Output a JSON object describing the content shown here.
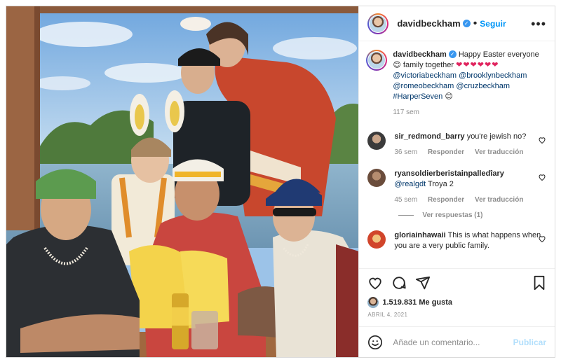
{
  "post": {
    "username": "davidbeckham",
    "follow_label": "Seguir",
    "more_label": "•••",
    "separator": "•"
  },
  "caption": {
    "username": "davidbeckham",
    "text_1": "Happy Easter everyone",
    "text_2": "family together",
    "hearts": "❤❤❤❤❤❤",
    "mentions": [
      "@victoriabeckham",
      "@brooklynbeckham",
      "@romeobeckham",
      "@cruzbeckham"
    ],
    "hashtag": "#HarperSeven",
    "time": "117 sem"
  },
  "comments": [
    {
      "username": "sir_redmond_barry",
      "text": "you're jewish no?",
      "time": "36 sem",
      "reply_label": "Responder",
      "translate_label": "Ver traducción"
    },
    {
      "username": "ryansoldierberistainpalledîary",
      "mention": "@realgdt",
      "text": "Troya 2",
      "time": "45 sem",
      "reply_label": "Responder",
      "translate_label": "Ver traducción",
      "view_replies": "Ver respuestas (1)"
    },
    {
      "username": "gloriainhawaii",
      "text": "This is what happens when you are a very public family."
    }
  ],
  "likes": {
    "count": "1.519.831",
    "label": "Me gusta"
  },
  "date": "ABRIL 4, 2021",
  "comment_input": {
    "placeholder": "Añade un comentario...",
    "publish_label": "Publicar"
  },
  "icons": {
    "verified": "verified-badge-icon",
    "like": "heart-icon",
    "comment": "comment-bubble-icon",
    "share": "paper-plane-icon",
    "save": "bookmark-icon",
    "emoji": "emoji-smiley-icon",
    "smile_emoji": "😊"
  },
  "colors": {
    "link": "#0095f6",
    "tag": "#00376b",
    "muted": "#8e8e8e",
    "publish_disabled": "#b2dffc"
  }
}
